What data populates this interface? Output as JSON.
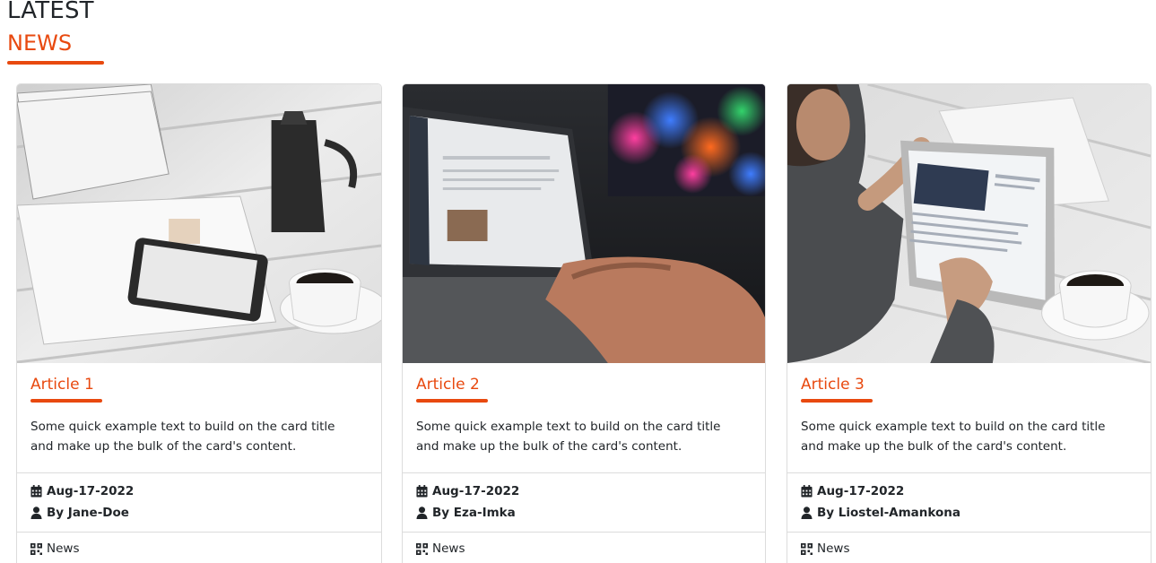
{
  "header": {
    "title_line1": "LATEST",
    "title_line2": "NEWS",
    "accent_color": "#e8490f"
  },
  "cards": [
    {
      "image_icon": "coffee-tablet-desk-photo",
      "title": "Article 1",
      "text": "Some quick example text to build on the card title and make up the bulk of the card's content.",
      "date": "Aug-17-2022",
      "author": "By Jane-Doe",
      "category": "News"
    },
    {
      "image_icon": "laptop-typing-photo",
      "title": "Article 2",
      "text": "Some quick example text to build on the card title and make up the bulk of the card's content.",
      "date": "Aug-17-2022",
      "author": "By Eza-Imka",
      "category": "News"
    },
    {
      "image_icon": "tablet-reading-photo",
      "title": "Article 3",
      "text": "Some quick example text to build on the card title and make up the bulk of the card's content.",
      "date": "Aug-17-2022",
      "author": "By Liostel-Amankona",
      "category": "News"
    }
  ]
}
